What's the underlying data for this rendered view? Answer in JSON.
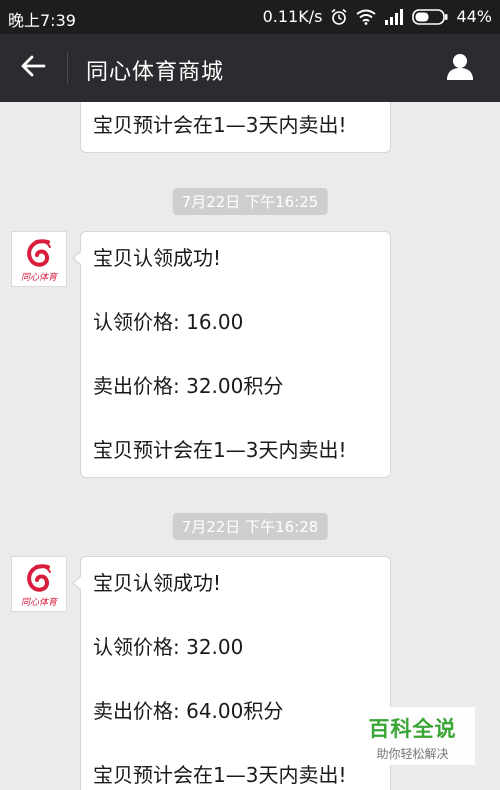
{
  "status_bar": {
    "time": "晚上7:39",
    "network_speed": "0.11K/s",
    "battery": "44%",
    "icons": [
      "alarm-icon",
      "wifi-icon",
      "signal-icon",
      "battery-icon"
    ]
  },
  "header": {
    "title": "同心体育商城",
    "back_icon": "back-arrow-icon",
    "profile_icon": "person-icon"
  },
  "messages": [
    {
      "timestamp": "",
      "sender_logo_text": "",
      "lines": [
        "宝贝预计会在1—3天内卖出!"
      ]
    },
    {
      "timestamp": "7月22日 下午16:25",
      "sender_logo_text": "同心体育",
      "lines": [
        "宝贝认领成功!",
        "认领价格: 16.00",
        "卖出价格: 32.00积分",
        "宝贝预计会在1—3天内卖出!"
      ]
    },
    {
      "timestamp": "7月22日 下午16:28",
      "sender_logo_text": "同心体育",
      "lines": [
        "宝贝认领成功!",
        "认领价格: 32.00",
        "卖出价格: 64.00积分",
        "宝贝预计会在1—3天内卖出!"
      ]
    }
  ],
  "watermark": {
    "main": "百科全说",
    "sub": "助你轻松解决"
  },
  "colors": {
    "status_bar_bg": "#1d1d1d",
    "header_bg": "#2a2c2f",
    "chat_bg": "#ebebeb",
    "logo_red": "#d81e3c",
    "watermark_green": "#3aa635"
  }
}
